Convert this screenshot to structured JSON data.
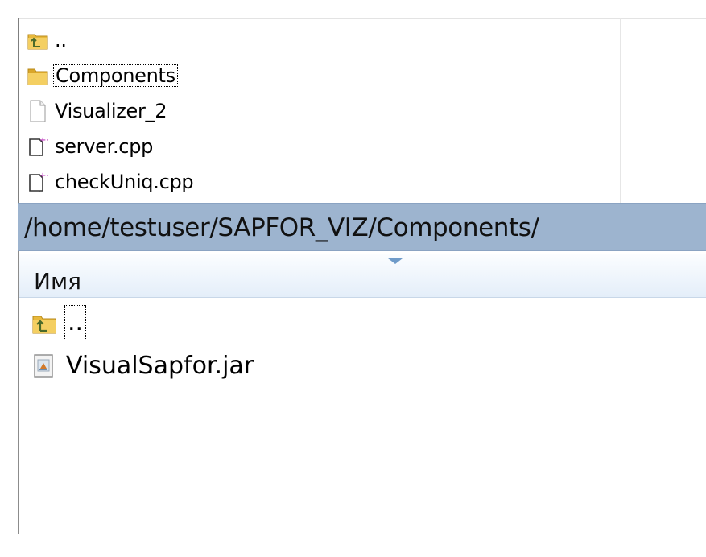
{
  "top_pane": {
    "items": [
      {
        "name": "..",
        "icon": "folder-up-icon",
        "focused": false
      },
      {
        "name": "Components",
        "icon": "folder-icon",
        "focused": true
      },
      {
        "name": "Visualizer_2",
        "icon": "file-icon",
        "focused": false
      },
      {
        "name": "server.cpp",
        "icon": "cpp-file-icon",
        "focused": false
      },
      {
        "name": "checkUniq.cpp",
        "icon": "cpp-file-icon",
        "focused": false
      }
    ]
  },
  "path_bar": {
    "path": "/home/testuser/SAPFOR_VIZ/Components/"
  },
  "bottom_pane": {
    "column_header": "Имя",
    "items": [
      {
        "name": "..",
        "icon": "folder-up-icon",
        "focused": true
      },
      {
        "name": "VisualSapfor.jar",
        "icon": "jar-file-icon",
        "focused": false
      }
    ]
  },
  "colors": {
    "path_bar": "#9db4cf",
    "header_gradient_top": "#fbfdff",
    "header_gradient_bottom": "#e4eef9",
    "folder": "#e8b93c",
    "sort_arrow": "#6f9bc9"
  }
}
